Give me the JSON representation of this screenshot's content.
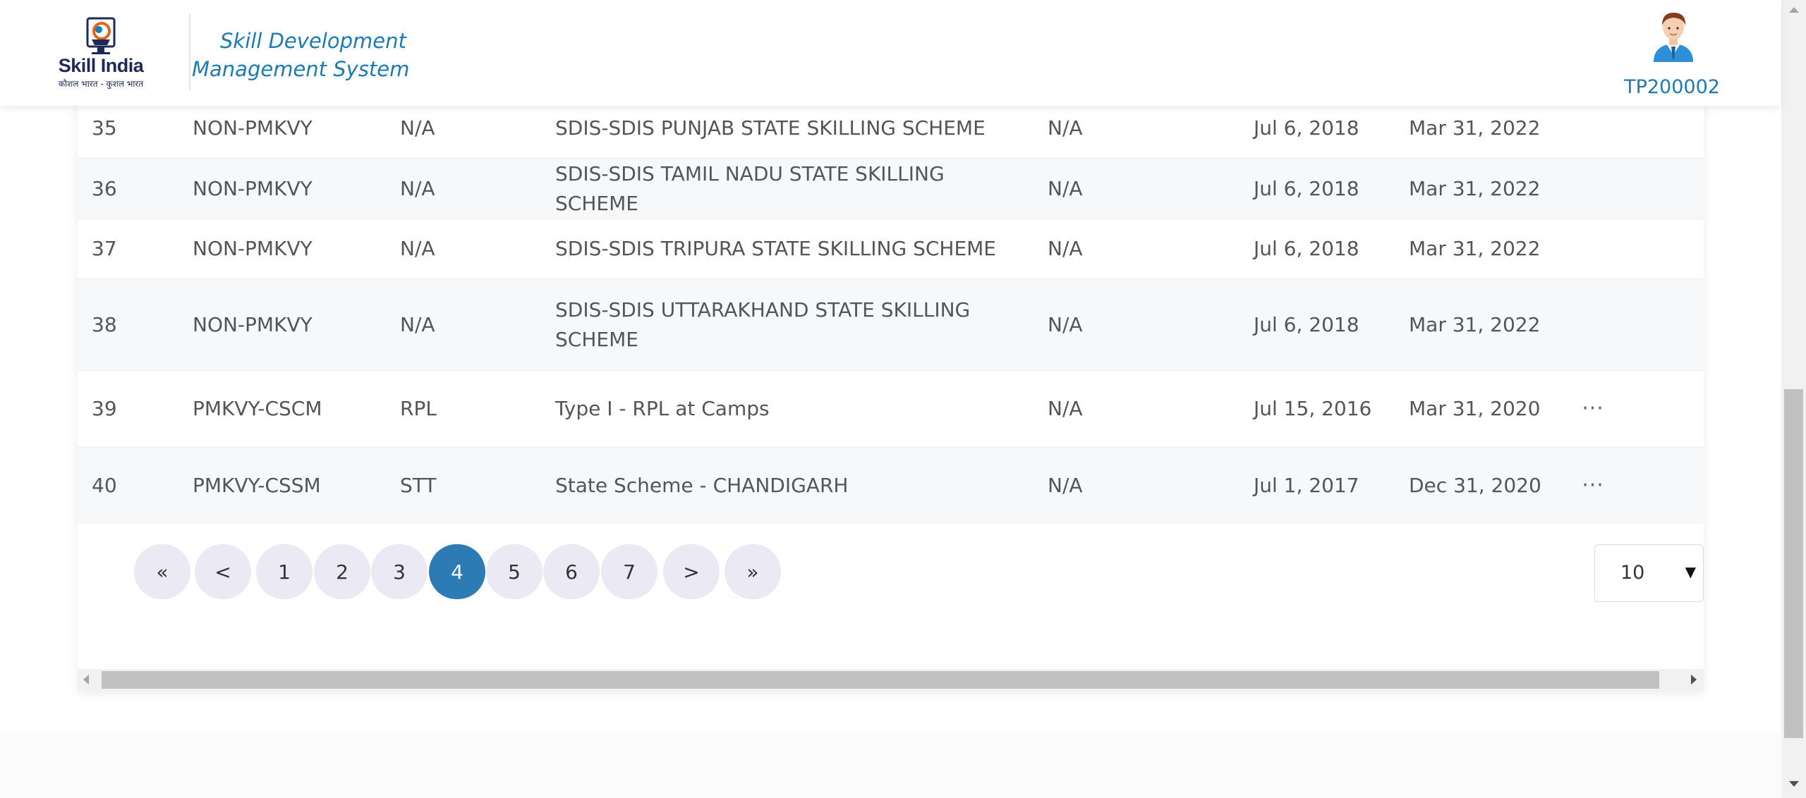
{
  "header": {
    "logo_text": "Skill India",
    "logo_tagline": "कौशल भारत - कुशल भारत",
    "app_title": "Skill Development Management System",
    "user_id": "TP200002"
  },
  "table": {
    "rows": [
      {
        "no": "35",
        "type": "NON-PMKVY",
        "sub": "N/A",
        "scheme": "SDIS-SDIS PUNJAB STATE SKILLING SCHEME",
        "na": "N/A",
        "start": "Jul 6, 2018",
        "end": "Mar 31, 2022",
        "action": ""
      },
      {
        "no": "36",
        "type": "NON-PMKVY",
        "sub": "N/A",
        "scheme": "SDIS-SDIS TAMIL NADU STATE SKILLING SCHEME",
        "na": "N/A",
        "start": "Jul 6, 2018",
        "end": "Mar 31, 2022",
        "action": ""
      },
      {
        "no": "37",
        "type": "NON-PMKVY",
        "sub": "N/A",
        "scheme": "SDIS-SDIS TRIPURA STATE SKILLING SCHEME",
        "na": "N/A",
        "start": "Jul 6, 2018",
        "end": "Mar 31, 2022",
        "action": ""
      },
      {
        "no": "38",
        "type": "NON-PMKVY",
        "sub": "N/A",
        "scheme": "SDIS-SDIS UTTARAKHAND STATE SKILLING SCHEME",
        "na": "N/A",
        "start": "Jul 6, 2018",
        "end": "Mar 31, 2022",
        "action": ""
      },
      {
        "no": "39",
        "type": "PMKVY-CSCM",
        "sub": "RPL",
        "scheme": "Type I - RPL at Camps",
        "na": "N/A",
        "start": "Jul 15, 2016",
        "end": "Mar 31, 2020",
        "action": "···"
      },
      {
        "no": "40",
        "type": "PMKVY-CSSM",
        "sub": "STT",
        "scheme": "State Scheme - CHANDIGARH",
        "na": "N/A",
        "start": "Jul 1, 2017",
        "end": "Dec 31, 2020",
        "action": "···"
      }
    ]
  },
  "pagination": {
    "first": "«",
    "prev": "<",
    "pages": [
      "1",
      "2",
      "3",
      "4",
      "5",
      "6",
      "7"
    ],
    "current": "4",
    "next": ">",
    "last": "»"
  },
  "page_size": {
    "value": "10",
    "arrow": "▼"
  },
  "colors": {
    "brand_blue": "#1c7ab4",
    "active_page": "#2d7bb4",
    "page_button": "#ebe9f3",
    "row_alt": "#f7f8fa"
  }
}
